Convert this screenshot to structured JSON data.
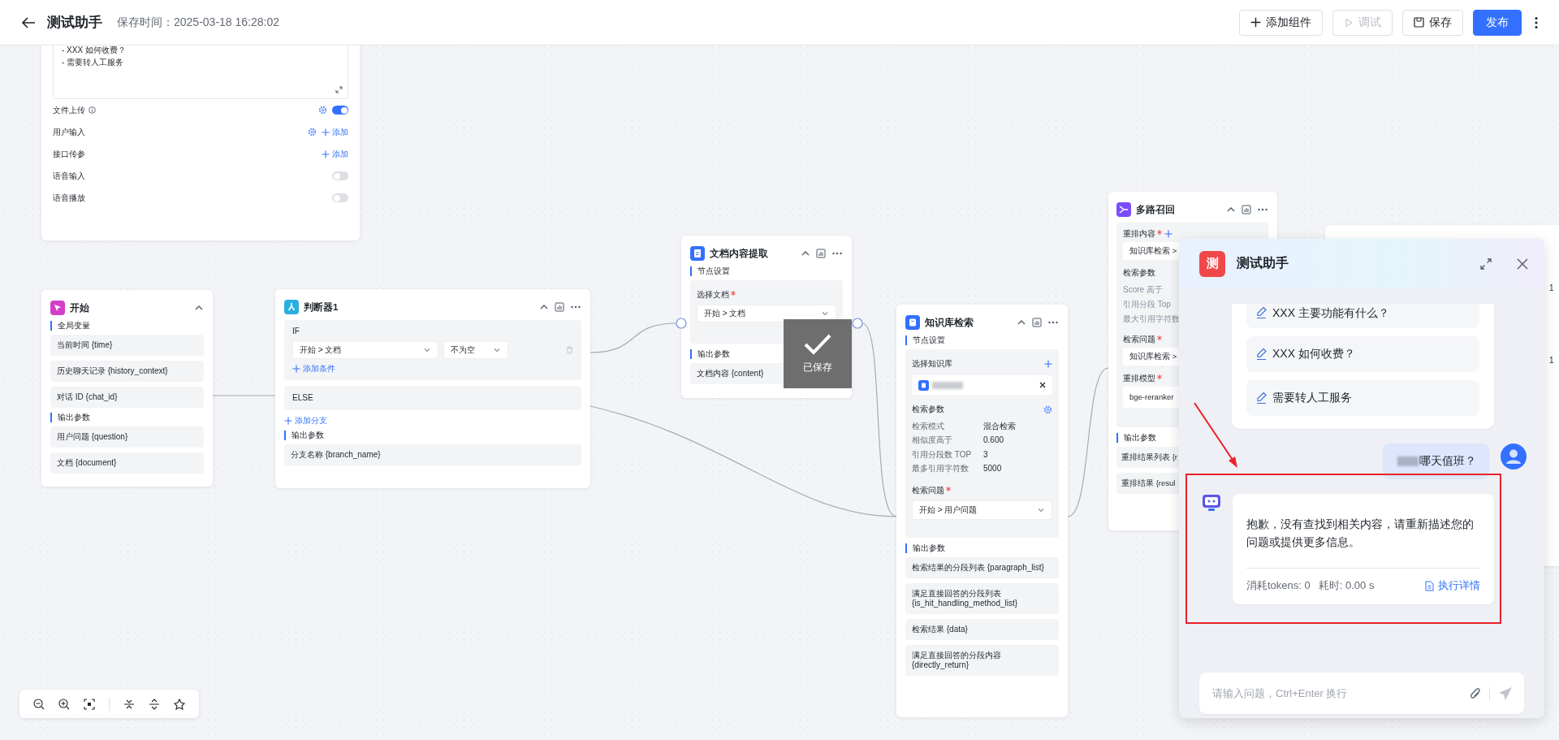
{
  "header": {
    "title": "测试助手",
    "save_time": "保存时间：2025-03-18 16:28:02",
    "buttons": [
      {
        "label": "添加组件",
        "kind": "add",
        "disabled": false
      },
      {
        "label": "调试",
        "kind": "run",
        "disabled": true
      },
      {
        "label": "保存",
        "kind": "save",
        "disabled": false
      },
      {
        "label": "发布",
        "kind": "primary",
        "disabled": false
      }
    ]
  },
  "settings_panel": {
    "prompt_lines": [
      "-  XXX  如何收费？",
      "-  需要转人工服务"
    ],
    "rows": [
      {
        "label": "文件上传",
        "kind": "toggle",
        "info": true,
        "settings": true,
        "on": true
      },
      {
        "label": "用户输入",
        "kind": "add",
        "settings": true,
        "action": "添加"
      },
      {
        "label": "接口传参",
        "kind": "add",
        "settings": false,
        "action": "添加"
      },
      {
        "label": "语音输入",
        "kind": "toggle",
        "on": false
      },
      {
        "label": "语音播放",
        "kind": "toggle",
        "on": false
      }
    ]
  },
  "start_node": {
    "title": "开始",
    "sections": [
      {
        "title": "全局变量",
        "items": [
          "当前时间 {time}",
          "历史聊天记录 {history_context}",
          "对话 ID {chat_id}"
        ]
      },
      {
        "title": "输出参数",
        "items": [
          "用户问题 {question}",
          "文档 {document}"
        ]
      }
    ]
  },
  "condition_node": {
    "title": "判断器1",
    "branches": [
      {
        "kind": "if",
        "label": "IF",
        "field": "开始 > 文档",
        "operator": "不为空",
        "add_condition": "添加条件"
      },
      {
        "kind": "else",
        "label": "ELSE"
      }
    ],
    "add_branch": "添加分支",
    "output_title": "输出参数",
    "outputs": [
      "分支名称 {branch_name}"
    ]
  },
  "doc_extract_node": {
    "title": "文档内容提取",
    "settings_title": "节点设置",
    "field": {
      "label": "选择文档",
      "required": true,
      "value": "开始 > 文档"
    },
    "output_title": "输出参数",
    "outputs": [
      "文档内容 {content}"
    ]
  },
  "saved_toast": {
    "text": "已保存"
  },
  "knowledge_node": {
    "title": "知识库检索",
    "settings_title": "节点设置",
    "kb_label": "选择知识库",
    "params_title": "检索参数",
    "params": [
      {
        "label": "检索模式",
        "value": "混合检索"
      },
      {
        "label": "相似度高于",
        "value": "0.600"
      },
      {
        "label": "引用分段数 TOP",
        "value": "3"
      },
      {
        "label": "最多引用字符数",
        "value": "5000"
      }
    ],
    "question": {
      "label": "检索问题",
      "required": true,
      "value": "开始 > 用户问题"
    },
    "output_title": "输出参数",
    "outputs": [
      "检索结果的分段列表 {paragraph_list}",
      "满足直接回答的分段列表 {is_hit_handling_method_list}",
      "检索结果 {data}",
      "满足直接回答的分段内容 {directly_return}"
    ]
  },
  "multi_recall_node": {
    "title": "多路召回",
    "content": {
      "label": "重排内容",
      "required": true,
      "value": "知识库检索 >"
    },
    "params_title": "检索参数",
    "params": [
      "Score 高于",
      "引用分段 Top",
      "最大引用字符数"
    ],
    "question": {
      "label": "检索问题",
      "required": true,
      "value": "知识库检索 >"
    },
    "model": {
      "label": "重排模型",
      "required": true,
      "value": "bge-reranker"
    },
    "output_title": "输出参数",
    "outputs": [
      "重排结果列表 {r",
      "重排结果 {resul"
    ]
  },
  "side_node": {
    "values": [
      "1",
      "1"
    ]
  },
  "chat_panel": {
    "avatar_char": "测",
    "title": "测试助手",
    "suggestions": [
      "XXX 主要功能有什么？",
      "XXX 如何收费？",
      "需要转人工服务"
    ],
    "user_message": "哪天值班？",
    "answer": "抱歉，没有查找到相关内容，请重新描述您的问题或提供更多信息。",
    "tokens": "消耗tokens: 0",
    "duration": "耗时: 0.00 s",
    "detail_link": "执行详情",
    "input_placeholder": "请输入问题，Ctrl+Enter 换行"
  }
}
